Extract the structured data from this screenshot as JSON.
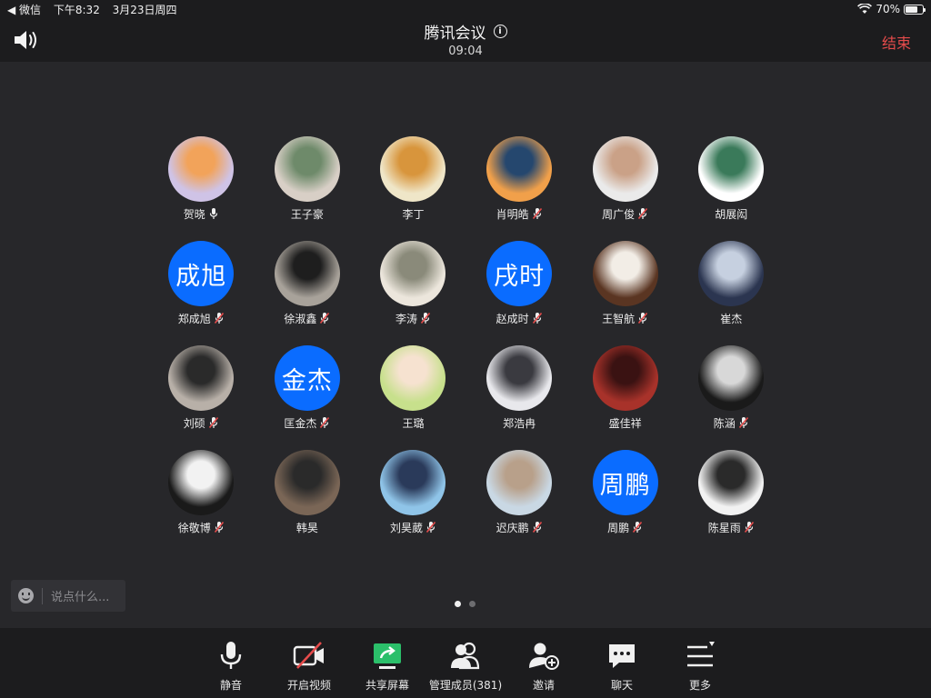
{
  "status_bar": {
    "back_app": "◀ 微信",
    "time": "下午8:32",
    "date": "3月23日周四",
    "battery": "70%",
    "battery_level": 0.7
  },
  "meeting": {
    "title": "腾讯会议",
    "timer": "09:04",
    "end_label": "结束"
  },
  "participants": [
    {
      "name": "贺晓",
      "avatar_type": "image",
      "mic": "on",
      "colors": [
        "#cfc3e6",
        "#f2a35a"
      ]
    },
    {
      "name": "王子豪",
      "avatar_type": "image",
      "mic": "none",
      "colors": [
        "#d8cfc6",
        "#6e8a6a"
      ]
    },
    {
      "name": "李丁",
      "avatar_type": "image",
      "mic": "none",
      "colors": [
        "#efe6c8",
        "#d8953c"
      ]
    },
    {
      "name": "肖明皓",
      "avatar_type": "image",
      "mic": "muted",
      "colors": [
        "#f1a04a",
        "#25476e"
      ]
    },
    {
      "name": "周广俊",
      "avatar_type": "image",
      "mic": "muted",
      "colors": [
        "#eaeaea",
        "#caa187"
      ]
    },
    {
      "name": "胡展闳",
      "avatar_type": "image",
      "mic": "none",
      "colors": [
        "#ffffff",
        "#3a7a5a"
      ]
    },
    {
      "name": "郑成旭",
      "avatar_type": "text",
      "avatar_text": "成旭",
      "mic": "muted"
    },
    {
      "name": "徐淑鑫",
      "avatar_type": "image",
      "mic": "muted",
      "colors": [
        "#a8a29a",
        "#1e1e1e"
      ]
    },
    {
      "name": "李涛",
      "avatar_type": "image",
      "mic": "muted",
      "colors": [
        "#ece6dc",
        "#8a8a7a"
      ]
    },
    {
      "name": "赵成时",
      "avatar_type": "text",
      "avatar_text": "戌时",
      "mic": "muted"
    },
    {
      "name": "王智航",
      "avatar_type": "image",
      "mic": "muted",
      "colors": [
        "#5a3522",
        "#f2ede6"
      ]
    },
    {
      "name": "崔杰",
      "avatar_type": "image",
      "mic": "none",
      "colors": [
        "#2b3550",
        "#c6d0e0"
      ]
    },
    {
      "name": "刘硕",
      "avatar_type": "image",
      "mic": "muted",
      "colors": [
        "#b8b0a8",
        "#2a2a2a"
      ]
    },
    {
      "name": "匡金杰",
      "avatar_type": "text",
      "avatar_text": "金杰",
      "mic": "muted"
    },
    {
      "name": "王璐",
      "avatar_type": "image",
      "mic": "none",
      "colors": [
        "#c7e08c",
        "#f6e2d0"
      ]
    },
    {
      "name": "郑浩冉",
      "avatar_type": "image",
      "mic": "none",
      "colors": [
        "#e8e8ec",
        "#3a3a40"
      ]
    },
    {
      "name": "盛佳祥",
      "avatar_type": "image",
      "mic": "none",
      "colors": [
        "#a8322a",
        "#3a1212"
      ]
    },
    {
      "name": "陈涵",
      "avatar_type": "image",
      "mic": "muted",
      "colors": [
        "#1a1a1a",
        "#d8d8d8"
      ]
    },
    {
      "name": "徐敬博",
      "avatar_type": "image",
      "mic": "muted",
      "colors": [
        "#1a1a1a",
        "#f2f2f2"
      ]
    },
    {
      "name": "韩昊",
      "avatar_type": "image",
      "mic": "none",
      "colors": [
        "#7a6656",
        "#2a2a2a"
      ]
    },
    {
      "name": "刘昊葳",
      "avatar_type": "image",
      "mic": "muted",
      "colors": [
        "#8fc4e8",
        "#2a3a5a"
      ]
    },
    {
      "name": "迟庆鹏",
      "avatar_type": "image",
      "mic": "muted",
      "colors": [
        "#c9d8e4",
        "#b8a08a"
      ]
    },
    {
      "name": "周鹏",
      "avatar_type": "text",
      "avatar_text": "周鹏",
      "mic": "muted"
    },
    {
      "name": "陈星雨",
      "avatar_type": "image",
      "mic": "muted",
      "colors": [
        "#f2f2f2",
        "#2a2a2a"
      ]
    }
  ],
  "chat": {
    "placeholder": "说点什么..."
  },
  "pagination": {
    "total": 2,
    "current": 1
  },
  "toolbar": [
    {
      "id": "mute",
      "label": "静音",
      "icon": "microphone-icon"
    },
    {
      "id": "video",
      "label": "开启视频",
      "icon": "video-off-icon"
    },
    {
      "id": "share",
      "label": "共享屏幕",
      "icon": "share-screen-icon"
    },
    {
      "id": "members",
      "label": "管理成员(381)",
      "icon": "members-icon"
    },
    {
      "id": "invite",
      "label": "邀请",
      "icon": "invite-icon"
    },
    {
      "id": "chat",
      "label": "聊天",
      "icon": "chat-icon"
    },
    {
      "id": "more",
      "label": "更多",
      "icon": "more-icon"
    }
  ],
  "colors": {
    "background": "#27272a",
    "bar": "#1c1c1e",
    "accent_blue": "#0a6cff",
    "end_red": "#e54b4b",
    "share_green": "#2bbf6a",
    "muted_red": "#e54b4b"
  }
}
